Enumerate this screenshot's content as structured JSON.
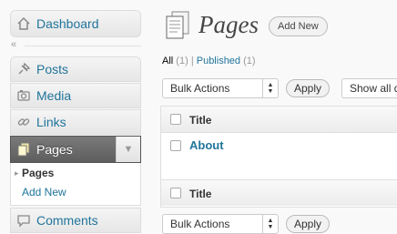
{
  "sidebar": {
    "dashboard": "Dashboard",
    "posts": "Posts",
    "media": "Media",
    "links": "Links",
    "pages": "Pages",
    "submenu": {
      "pages": "Pages",
      "add_new": "Add New"
    },
    "comments": "Comments"
  },
  "main": {
    "title": "Pages",
    "add_new": "Add New",
    "filters": {
      "all_label": "All",
      "all_count": "(1)",
      "separator": "|",
      "published_label": "Published",
      "published_count": "(1)"
    },
    "bulk_actions": "Bulk Actions",
    "apply": "Apply",
    "show_all_dates": "Show all d",
    "table": {
      "header": "Title",
      "footer": "Title",
      "rows": [
        {
          "title": "About"
        }
      ]
    }
  },
  "colors": {
    "link": "#21759b",
    "current_menu": "#6d6d6d"
  }
}
